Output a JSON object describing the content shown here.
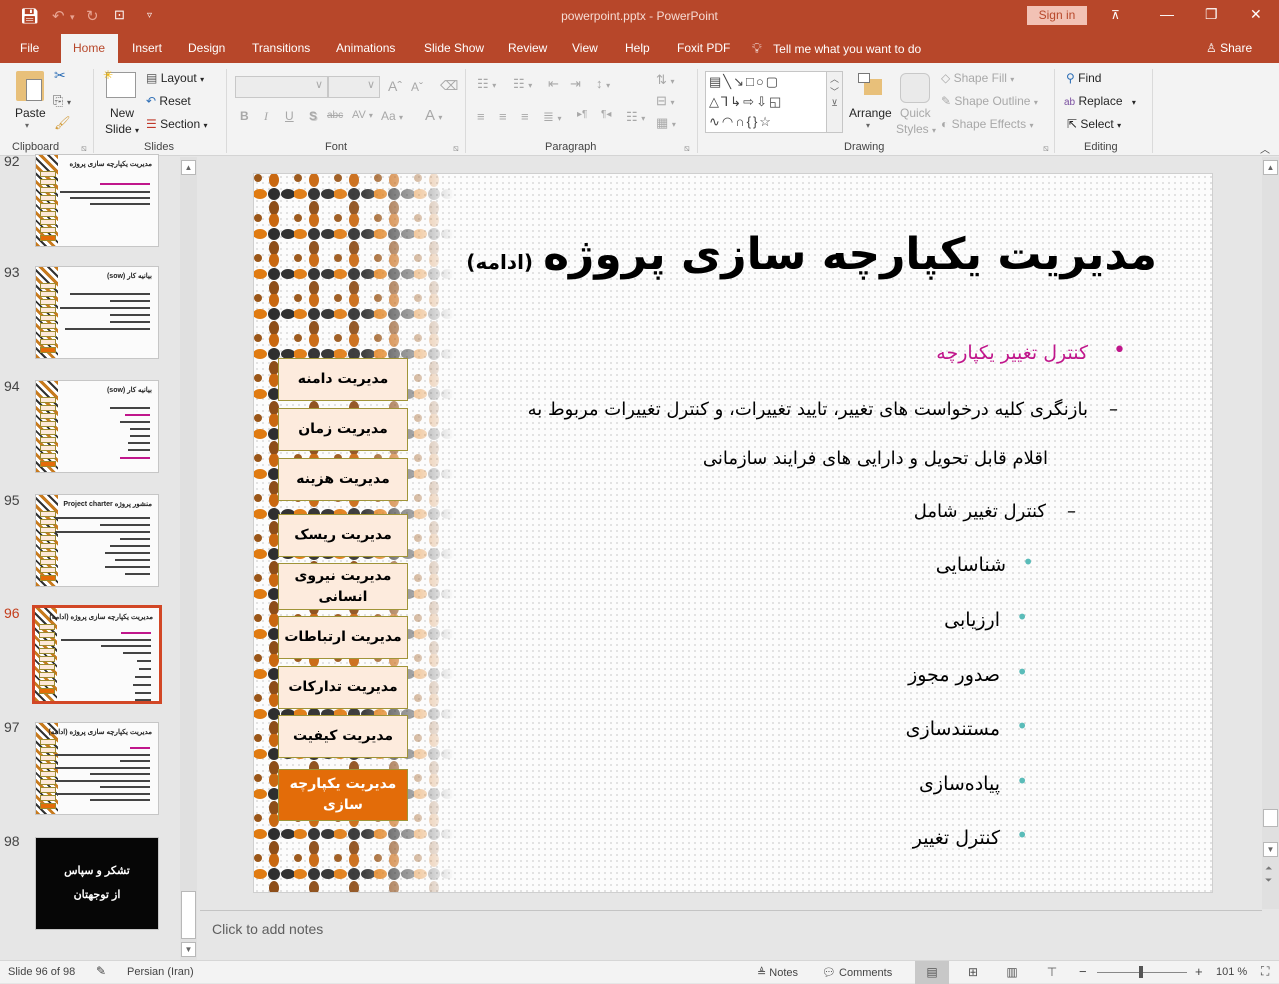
{
  "window": {
    "title": "powerpoint.pptx  -  PowerPoint",
    "sign_in": "Sign in",
    "qat": {
      "save": "save-icon",
      "undo": "undo-icon",
      "redo": "redo-icon",
      "present": "start-from-beginning-icon",
      "customize": "customize-qat-icon"
    },
    "controls": {
      "ribbon_display": "ribbon-display-options-icon",
      "minimize": "—",
      "restore": "❐",
      "close": "✕"
    }
  },
  "tabs": [
    {
      "label": "File"
    },
    {
      "label": "Home",
      "active": true
    },
    {
      "label": "Insert"
    },
    {
      "label": "Design"
    },
    {
      "label": "Transitions"
    },
    {
      "label": "Animations"
    },
    {
      "label": "Slide Show"
    },
    {
      "label": "Review"
    },
    {
      "label": "View"
    },
    {
      "label": "Help"
    },
    {
      "label": "Foxit PDF"
    }
  ],
  "tell_me": "Tell me what you want to do",
  "share": "Share",
  "ribbon": {
    "clipboard": {
      "label": "Clipboard",
      "paste": "Paste"
    },
    "slides": {
      "label": "Slides",
      "new_slide_1": "New",
      "new_slide_2": "Slide",
      "layout": "Layout",
      "reset": "Reset",
      "section": "Section"
    },
    "font": {
      "label": "Font",
      "font_name": "",
      "font_size": "",
      "bold": "B",
      "italic": "I",
      "underline": "U",
      "shadow": "S",
      "strike": "abc",
      "spacing": "AV",
      "case": "Aa",
      "color": "A"
    },
    "paragraph": {
      "label": "Paragraph"
    },
    "drawing": {
      "label": "Drawing",
      "arrange": "Arrange",
      "quick_styles_1": "Quick",
      "quick_styles_2": "Styles",
      "shape_fill": "Shape Fill",
      "shape_outline": "Shape Outline",
      "shape_effects": "Shape Effects"
    },
    "editing": {
      "label": "Editing",
      "find": "Find",
      "replace": "Replace",
      "select": "Select"
    }
  },
  "thumbnails": [
    {
      "number": "92",
      "title": "مدیریت یکپارچه سازی پروژه"
    },
    {
      "number": "93",
      "title": "بیانیه کار (sow)"
    },
    {
      "number": "94",
      "title": "بیانیه کار (sow)"
    },
    {
      "number": "95",
      "title": "منشور پروژه Project charter"
    },
    {
      "number": "96",
      "title": "مدیریت یکپارچه سازی پروژه (ادامه)",
      "active": true
    },
    {
      "number": "97",
      "title": "مدیریت یکپارچه سازی پروژه (ادامه)"
    },
    {
      "number": "98",
      "title_line1": "تشکر و سپاس",
      "title_line2": "از توجهتان",
      "dark": true
    }
  ],
  "slide": {
    "title": "مدیریت یکپارچه سازی پروژه",
    "title_suffix": "(ادامه)",
    "nav_boxes": [
      "مدیریت دامنه",
      "مدیریت زمان",
      "مدیریت هزینه",
      "مدیریت ریسک",
      "مدیریت نیروی انسانی",
      "مدیریت ارتباطات",
      "مدیریت تدارکات",
      "مدیریت کیفیت",
      "مدیریت یکپارچه سازی"
    ],
    "active_nav": "مدیریت یکپارچه سازی",
    "bullet_main": "کنترل تغییر یکپارچه",
    "sub_1_line1": "بازنگری کلیه درخواست های تغییر، تایید تغییرات، و کنترل تغییرات مربوط به",
    "sub_1_line2": "اقلام قابل تحویل و دارایی های فرایند سازمانی",
    "sub_2": "کنترل تغییر  شامل",
    "items": [
      "شناسایی",
      "ارزیابی",
      "صدور مجوز",
      "مستندسازی",
      "پیاده‌سازی",
      "کنترل تغییر"
    ],
    "colors": {
      "accent_pink": "#c0168b",
      "bullet_teal": "#5abcb9",
      "nav_fill": "#fdebdd",
      "nav_active": "#e36c09",
      "nav_border": "#a09438"
    }
  },
  "notes": {
    "placeholder": "Click to add notes"
  },
  "status": {
    "slide_counter": "Slide 96 of 98",
    "language": "Persian (Iran)",
    "notes": "Notes",
    "comments": "Comments",
    "zoom": "101 %",
    "zoom_minus": "−",
    "zoom_plus": "+"
  },
  "theme": {
    "brand": "#b7472a",
    "selected_thumb": "#d24726"
  }
}
